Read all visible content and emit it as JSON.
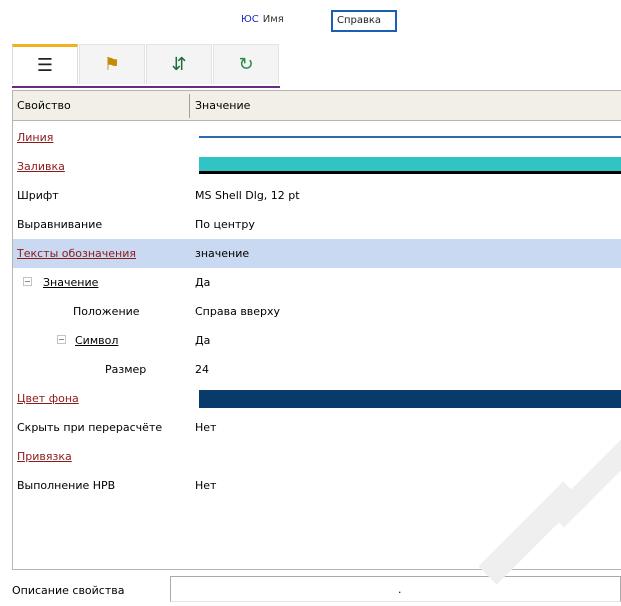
{
  "window": {
    "top_id_label": "ЮС",
    "top_label": "Имя",
    "top_button": "Справка"
  },
  "tabs": [
    {
      "icon": "list-icon",
      "glyph": "☰"
    },
    {
      "icon": "wizard-icon",
      "glyph": "⚑"
    },
    {
      "icon": "tree-icon",
      "glyph": "⇵"
    },
    {
      "icon": "refresh-icon",
      "glyph": "↻"
    }
  ],
  "grid": {
    "header": {
      "col_name": "Свойство",
      "col_value": "Значение"
    },
    "rows": [
      {
        "name": "Линия",
        "value": "",
        "style": "link",
        "indent": 4
      },
      {
        "name": "Заливка",
        "value": "",
        "style": "link",
        "indent": 4
      },
      {
        "name": "Шрифт",
        "value": "MS Shell Dlg, 12 pt",
        "style": "plain",
        "indent": 4
      },
      {
        "name": "Выравнивание",
        "value": "По центру",
        "style": "plain",
        "indent": 4
      },
      {
        "name": "Тексты обозначения",
        "value": "значение",
        "style": "link",
        "indent": 4,
        "selected": true
      },
      {
        "name": "Значение",
        "value": "Да",
        "style": "link-dark",
        "indent": 22,
        "toggle": true
      },
      {
        "name": "Положение",
        "value": "Справа вверху",
        "style": "plain",
        "indent": 60
      },
      {
        "name": "Символ",
        "value": "Да",
        "style": "link-dark",
        "indent": 60,
        "toggle": true
      },
      {
        "name": "Размер",
        "value": "24",
        "style": "plain",
        "indent": 92
      },
      {
        "name": "Цвет фона",
        "value": "",
        "style": "link",
        "indent": 4
      },
      {
        "name": "Скрыть при перерасчёте",
        "value": "Нет",
        "style": "plain",
        "indent": 4
      },
      {
        "name": "Привязка",
        "value": "",
        "style": "link",
        "indent": 4
      },
      {
        "name": "Выполнение HPB",
        "value": "Нет",
        "style": "plain",
        "indent": 4
      }
    ]
  },
  "footer": {
    "label": "Описание свойства",
    "value": "."
  },
  "colors": {
    "line_bar": "#2b6cb0",
    "fill_bar": "#30c4c4",
    "background_bar": "#083a6b",
    "selection": "#c9d9f2",
    "link": "#8b1a1a"
  }
}
